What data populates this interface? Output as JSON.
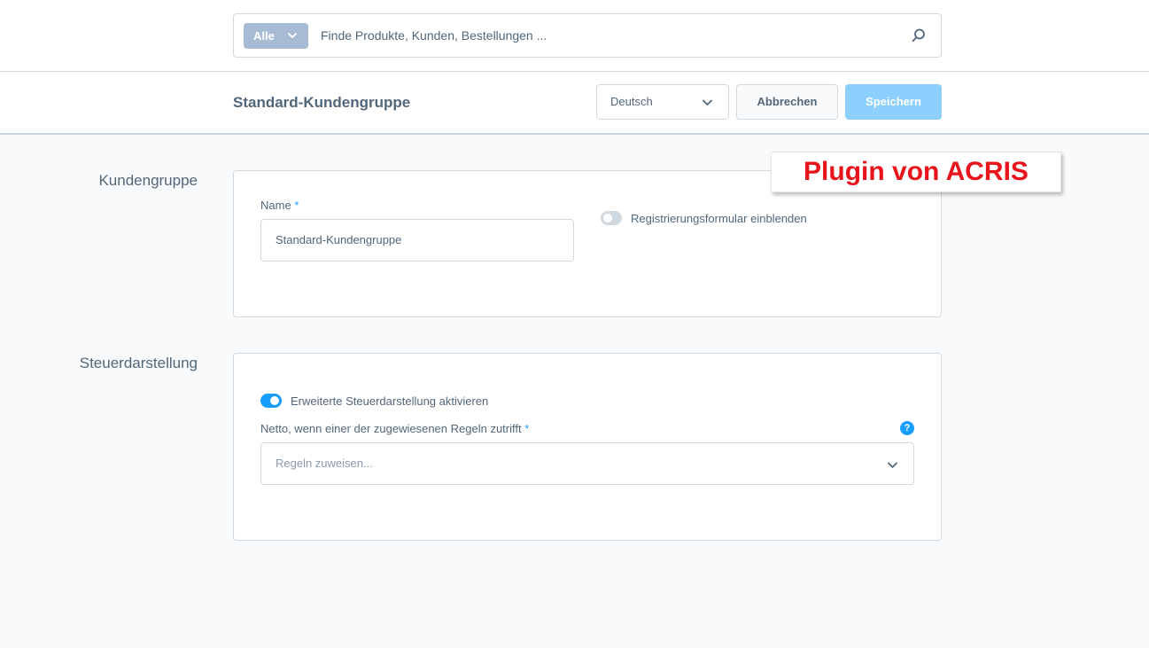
{
  "search": {
    "type_label": "Alle",
    "placeholder": "Finde Produkte, Kunden, Bestellungen ..."
  },
  "smartbar": {
    "title": "Standard-Kundengruppe",
    "language": "Deutsch",
    "cancel_label": "Abbrechen",
    "save_label": "Speichern"
  },
  "sections": {
    "customer_group": {
      "label": "Kundengruppe",
      "name_label": "Name",
      "required_mark": "*",
      "name_value": "Standard-Kundengruppe",
      "registration_toggle_label": "Registrierungsformular einblenden",
      "registration_toggle_on": false
    },
    "tax_display": {
      "label": "Steuerdarstellung",
      "extended_toggle_label": "Erweiterte Steuerdarstellung aktivieren",
      "extended_toggle_on": true,
      "rules_label": "Netto, wenn einer der zugewiesenen Regeln zutrifft",
      "required_mark": "*",
      "help_glyph": "?",
      "rules_placeholder": "Regeln zuweisen..."
    }
  },
  "overlay": {
    "text": "Plugin von ACRIS"
  },
  "colors": {
    "accent": "#189eff",
    "save_button": "#8ed0fd",
    "overlay_text": "#e8141b"
  },
  "icons": {
    "search": "magnifier-icon",
    "chevron": "chevron-down-icon",
    "help": "question-circle-icon"
  }
}
